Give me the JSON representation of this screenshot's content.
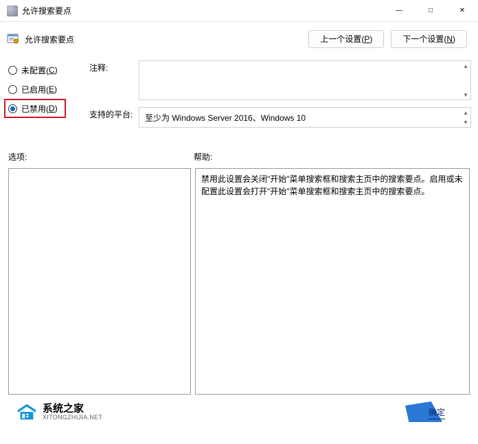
{
  "window": {
    "title": "允许搜索要点"
  },
  "policy_header": {
    "title": "允许搜索要点"
  },
  "nav": {
    "prev_pre": "上一个设置(",
    "prev_key": "P",
    "prev_post": ")",
    "next_pre": "下一个设置(",
    "next_key": "N",
    "next_post": ")"
  },
  "radios": {
    "notconf_pre": "未配置(",
    "notconf_key": "C",
    "notconf_post": ")",
    "enabled_pre": "已启用(",
    "enabled_key": "E",
    "enabled_post": ")",
    "disabled_pre": "已禁用(",
    "disabled_key": "D",
    "disabled_post": ")",
    "selected": "disabled"
  },
  "labels": {
    "comment": "注释:",
    "supported": "支持的平台:",
    "options": "选项:",
    "help": "帮助:"
  },
  "supported_text": "至少为 Windows Server 2016、Windows 10",
  "help_text": "禁用此设置会关闭\"开始\"菜单搜索框和搜索主页中的搜索要点。启用或未配置此设置会打开\"开始\"菜单搜索框和搜索主页中的搜索要点。",
  "footer": {
    "brand_name": "系统之家",
    "brand_sub": "XITONGZHIJIA.NET",
    "ok_label": "确定"
  }
}
